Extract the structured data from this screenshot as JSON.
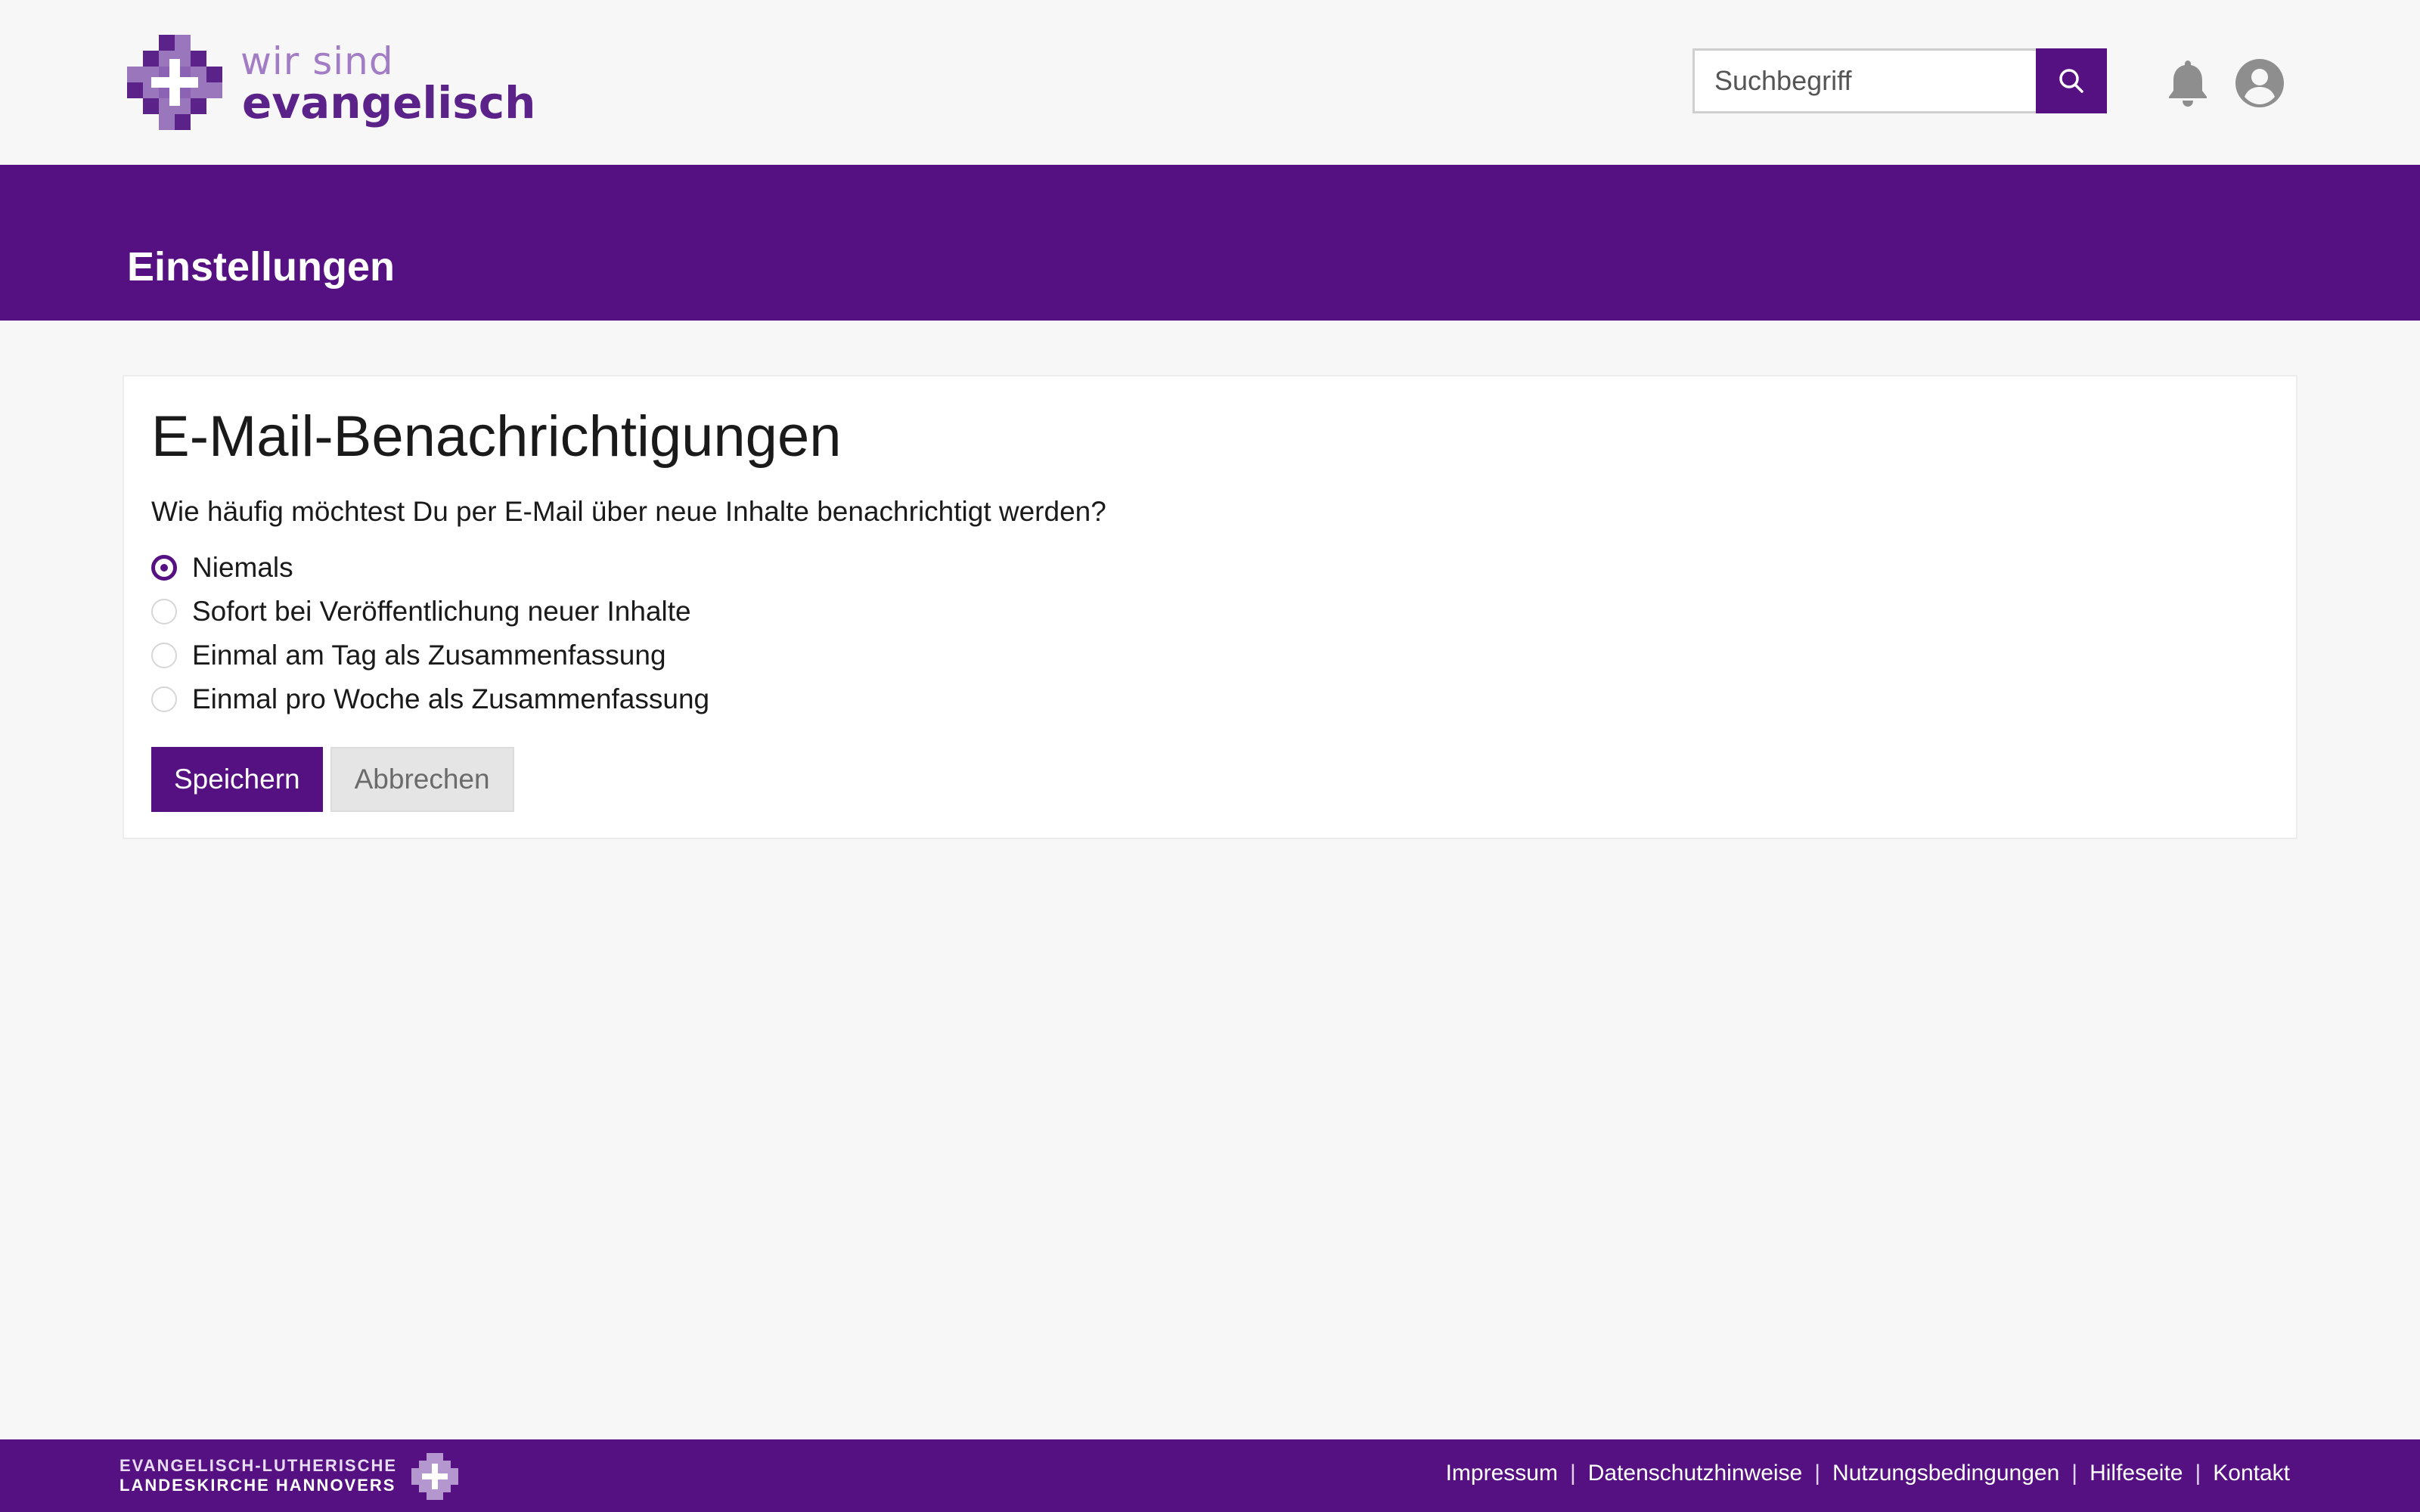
{
  "header": {
    "logo": {
      "line1": "wir sind",
      "line2": "evangelisch"
    },
    "search": {
      "placeholder": "Suchbegriff"
    }
  },
  "banner": {
    "title": "Einstellungen"
  },
  "settings": {
    "title": "E-Mail-Benachrichtigungen",
    "question": "Wie häufig möchtest Du per E-Mail über neue Inhalte benachrichtigt werden?",
    "options": [
      {
        "label": "Niemals",
        "checked": true
      },
      {
        "label": "Sofort bei Veröffentlichung neuer Inhalte",
        "checked": false
      },
      {
        "label": "Einmal am Tag als Zusammenfassung",
        "checked": false
      },
      {
        "label": "Einmal pro Woche als Zusammenfassung",
        "checked": false
      }
    ],
    "save_label": "Speichern",
    "cancel_label": "Abbrechen"
  },
  "footer": {
    "org_line1": "EVANGELISCH-LUTHERISCHE",
    "org_line2": "LANDESKIRCHE HANNOVERS",
    "links": [
      "Impressum",
      "Datenschutzhinweise",
      "Nutzungsbedingungen",
      "Hilfeseite",
      "Kontakt"
    ]
  },
  "colors": {
    "brand": "#551181",
    "logo_light": "#a27cc4",
    "background": "#f7f7f7"
  },
  "icons": [
    "logo-cross-icon",
    "search-icon",
    "bell-icon",
    "user-avatar-icon"
  ]
}
